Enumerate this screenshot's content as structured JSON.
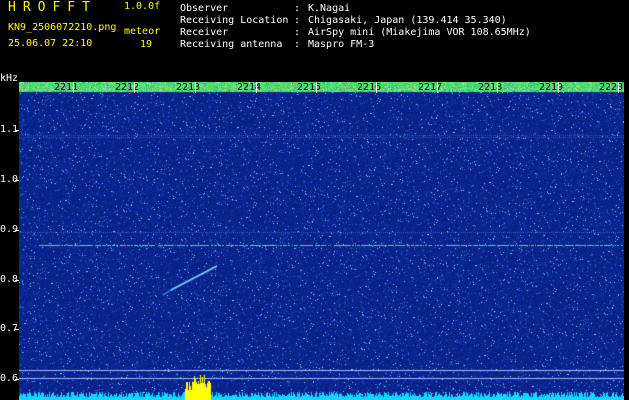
{
  "header": {
    "app_title": "HROFFT",
    "version": "1.0.0f",
    "filename": "KN9_2506072210.png",
    "meteor_label": "meteor",
    "datetime": "25.06.07 22:10",
    "meteor_count": "19"
  },
  "station_info": [
    {
      "label": "Observer",
      "value": "K.Nagai"
    },
    {
      "label": "Receiving Location",
      "value": "Chigasaki, Japan (139.414 35.340)"
    },
    {
      "label": "Receiver",
      "value": "AirSpy mini (Miakejima VOR 108.65MHz)"
    },
    {
      "label": "Receiving antenna",
      "value": "Maspro FM-3"
    }
  ],
  "axis": {
    "y_unit": "kHz",
    "y_ticks": [
      "1.1",
      "1.0",
      "0.9",
      "0.8",
      "0.7",
      "0.6"
    ],
    "x_ticks": [
      "2211",
      "2212",
      "2213",
      "2214",
      "2215",
      "2216",
      "2217",
      "2218",
      "2219",
      "2220"
    ]
  },
  "colors": {
    "background": "#0a1a8c",
    "carrier_line": "#40d0e0",
    "meteor_echo": "#80e0ff",
    "burst": "#ffff00",
    "text_yellow": "#ffff00",
    "text_white": "#ffffff"
  }
}
